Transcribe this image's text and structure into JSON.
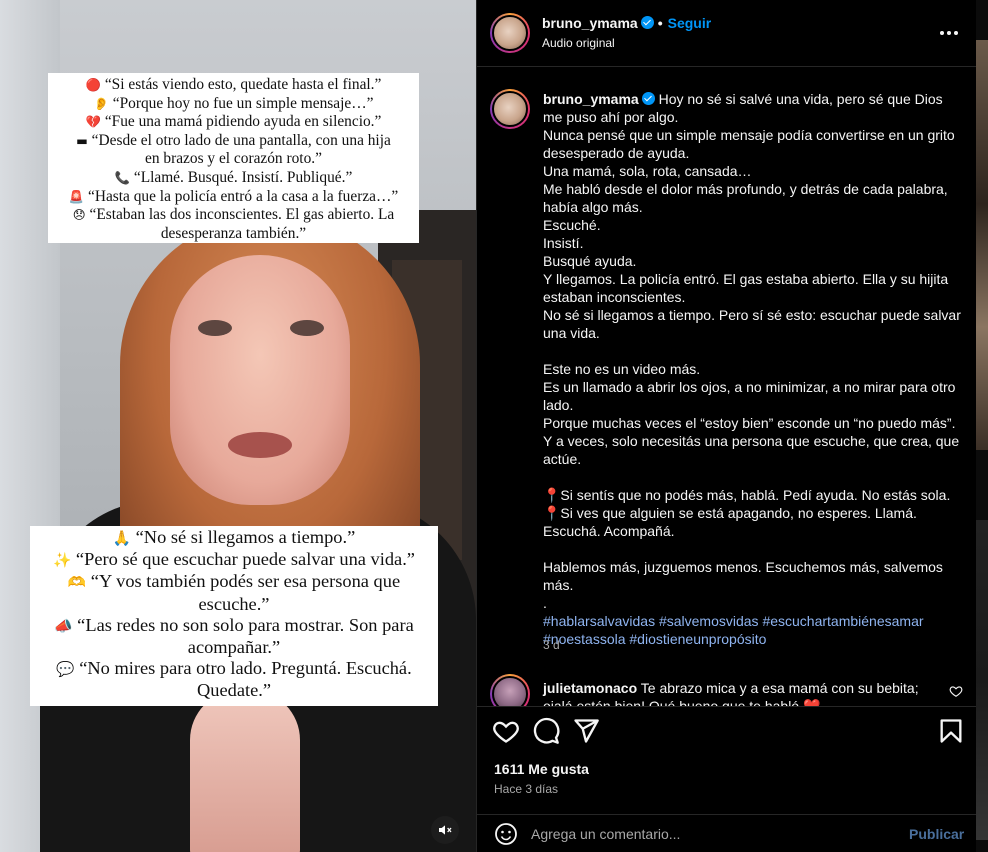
{
  "video": {
    "caption_top": [
      {
        "icon": "🔴",
        "text": "“Si estás viendo esto, quedate hasta el final.”"
      },
      {
        "icon": "👂",
        "text": "“Porque hoy no fue un simple mensaje…”"
      },
      {
        "icon": "💔",
        "text": "“Fue una mamá pidiendo ayuda en silencio.”"
      },
      {
        "icon": "▬",
        "text": "“Desde el otro lado de una pantalla, con una hija"
      },
      {
        "icon": "",
        "text": "en brazos y el corazón roto.”"
      },
      {
        "icon": "📞",
        "text": "“Llamé. Busqué. Insistí. Publiqué.”"
      },
      {
        "icon": "🚨",
        "text": "“Hasta que la policía entró a la casa a la fuerza…”"
      },
      {
        "icon": "😞",
        "text": "“Estaban las dos inconscientes. El gas abierto. La"
      },
      {
        "icon": "",
        "text": "desesperanza también.”"
      }
    ],
    "caption_bottom": [
      {
        "icon": "🙏",
        "text": "“No sé si llegamos a tiempo.”"
      },
      {
        "icon": "✨",
        "text": "“Pero sé que escuchar puede salvar una vida.”"
      },
      {
        "icon": "🫶",
        "text": "“Y vos también podés ser esa persona que"
      },
      {
        "icon": "",
        "text": "escuche.”"
      },
      {
        "icon": "📣",
        "text": "“Las redes no son solo para mostrar. Son para"
      },
      {
        "icon": "",
        "text": "acompañar.”"
      },
      {
        "icon": "💬",
        "text": "“No mires para otro lado. Preguntá. Escuchá."
      },
      {
        "icon": "",
        "text": "Quedate.”"
      }
    ],
    "mute_icon": "speaker-muted-icon"
  },
  "header": {
    "username": "bruno_ymama",
    "follow_label": "Seguir",
    "audio_label": "Audio original"
  },
  "post": {
    "username": "bruno_ymama",
    "lines": [
      "Hoy no sé si salvé una vida, pero sé que Dios me puso ahí por algo.",
      "Nunca pensé que un simple mensaje podía convertirse en un grito desesperado de ayuda.",
      "Una mamá, sola, rota, cansada…",
      "Me habló desde el dolor más profundo, y detrás de cada palabra, había algo más.",
      "Escuché.",
      "Insistí.",
      "Busqué ayuda.",
      "Y llegamos. La policía entró. El gas estaba abierto. Ella y su hijita estaban inconscientes.",
      "No sé si llegamos a tiempo. Pero sí sé esto: escuchar puede salvar una vida.",
      "",
      "Este no es un video más.",
      "Es un llamado a abrir los ojos, a no minimizar, a no mirar para otro lado.",
      "Porque muchas veces el “estoy bien” esconde un “no puedo más”.",
      "Y a veces, solo necesitás una persona que escuche, que crea, que actúe.",
      "",
      "📍Si sentís que no podés más, hablá. Pedí ayuda. No estás sola.",
      "📍Si ves que alguien se está apagando, no esperes. Llamá. Escuchá. Acompañá.",
      "",
      "Hablemos más, juzguemos menos. Escuchemos más, salvemos más.",
      "."
    ],
    "hashtags": "#hablarsalvavidas #salvemosvidas #escuchartambiénesamar #noestassola #diostieneunpropósito",
    "time": "3 d"
  },
  "comment": {
    "username": "julietamonaco",
    "text": "Te abrazo mica y a esa mamá con su bebita; ojalá estén bien! Qué bueno que te habló ❤️"
  },
  "actions": {
    "likes": "1611 Me gusta",
    "ago": "Hace 3 días"
  },
  "compose": {
    "placeholder": "Agrega un comentario...",
    "publish_label": "Publicar"
  },
  "colors": {
    "background": "#000000",
    "accent": "#0095f6",
    "hashtag": "#8fb4f0",
    "muted_text": "#a8a8a8"
  }
}
